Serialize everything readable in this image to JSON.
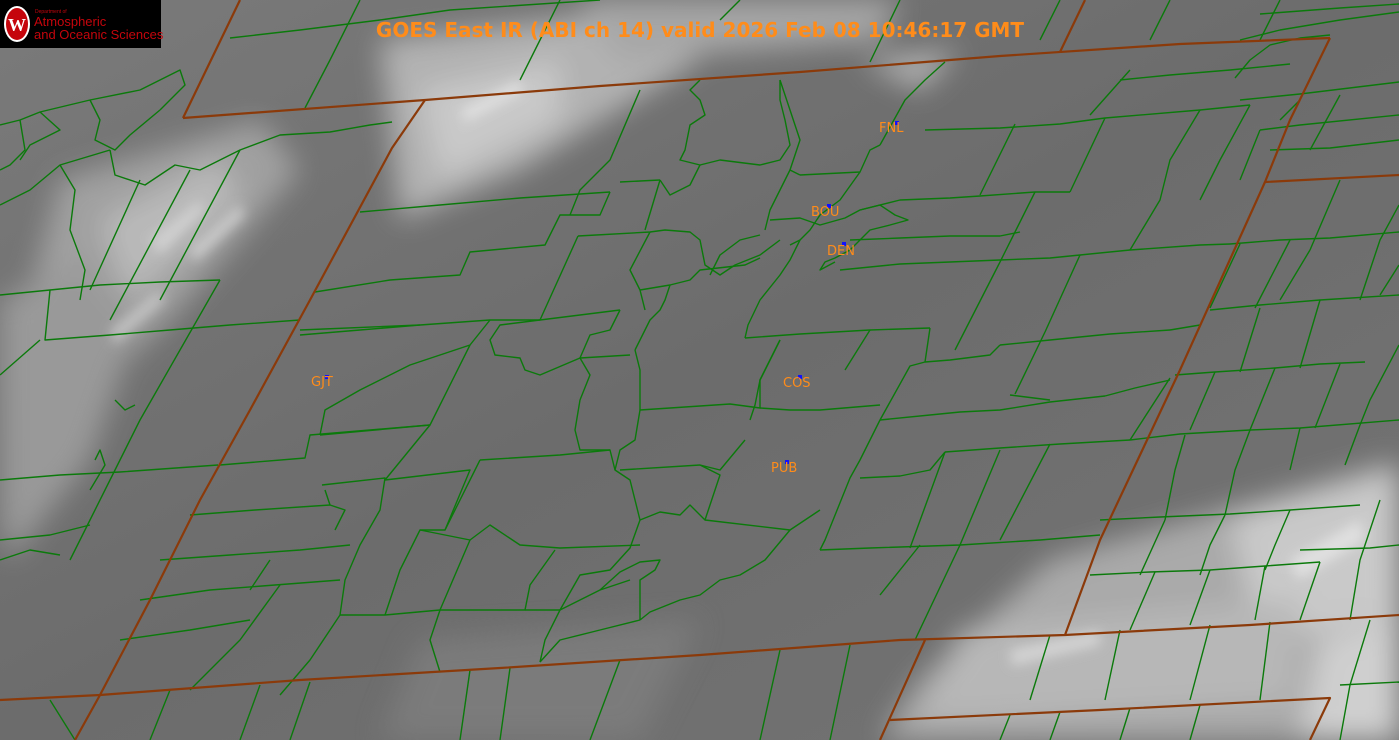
{
  "title": "GOES East IR (ABI ch 14) valid 2026 Feb 08 10:46:17 GMT",
  "logo": {
    "department": "Department of",
    "line1": "Atmospheric",
    "line2": "and Oceanic Sciences",
    "emblem_letter": "W",
    "shield_color": "#c5050c",
    "text_color": "#c5050c"
  },
  "stations": [
    {
      "id": "FNL"
    },
    {
      "id": "BOU"
    },
    {
      "id": "DEN"
    },
    {
      "id": "GJT"
    },
    {
      "id": "COS"
    },
    {
      "id": "PUB"
    }
  ],
  "colors": {
    "title": "#ff8c1a",
    "station_label": "#ff8c1a",
    "station_marker": "#1010ff",
    "county_border": "#0b7a0b",
    "state_border": "#8b3a0a",
    "cloud_field": "#6e6e6e",
    "cloud_bright": "#e6e6e6"
  }
}
